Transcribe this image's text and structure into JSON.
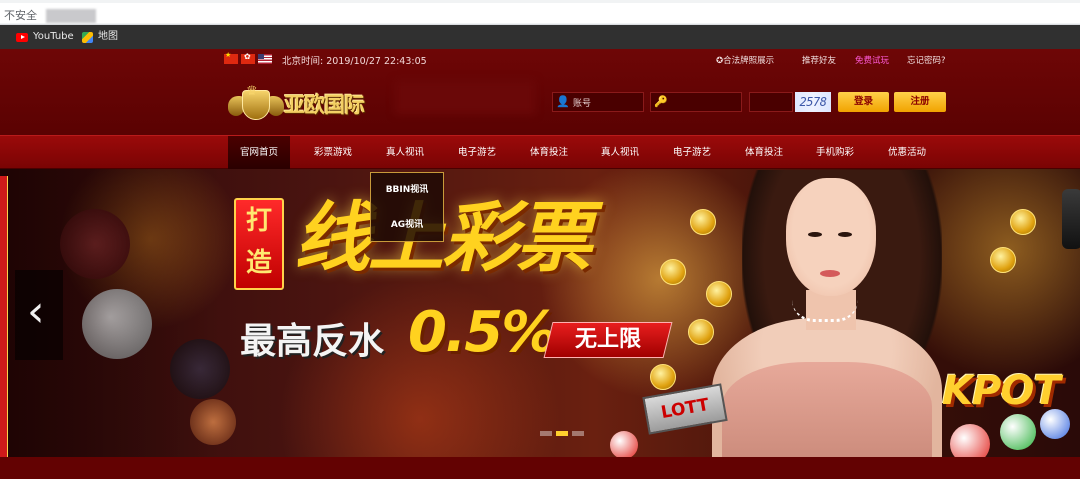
{
  "browser": {
    "security_label": "不安全",
    "bookmarks": [
      "YouTube",
      "地图"
    ]
  },
  "header": {
    "datetime": "北京时间: 2019/10/27 22:43:05",
    "links": [
      "合法牌照展示",
      "推荐好友",
      "免费试玩",
      "忘记密码?"
    ],
    "brand": "亚欧国际",
    "username_placeholder": "账号",
    "password_placeholder": "",
    "captcha_code": "2578",
    "login_label": "登录",
    "register_label": "注册"
  },
  "nav": {
    "items": [
      "官网首页",
      "彩票游戏",
      "真人视讯",
      "电子游艺",
      "体育投注",
      "真人视讯",
      "电子游艺",
      "体育投注",
      "手机购彩",
      "优惠活动"
    ],
    "dropdown": [
      "BBIN视讯",
      "AG视讯"
    ]
  },
  "banner": {
    "tag": "打造",
    "headline": "线上彩票",
    "rebate_label": "最高反水",
    "rebate_value": "0.5%",
    "badge": "无上限",
    "jackpot": "KPOT",
    "lotto_label": "LOTT"
  },
  "colors": {
    "page_bg": "#5a0000",
    "nav_bg": "#8a0808",
    "accent_gold": "#ffd21f",
    "button_gold": "#f1a300"
  }
}
